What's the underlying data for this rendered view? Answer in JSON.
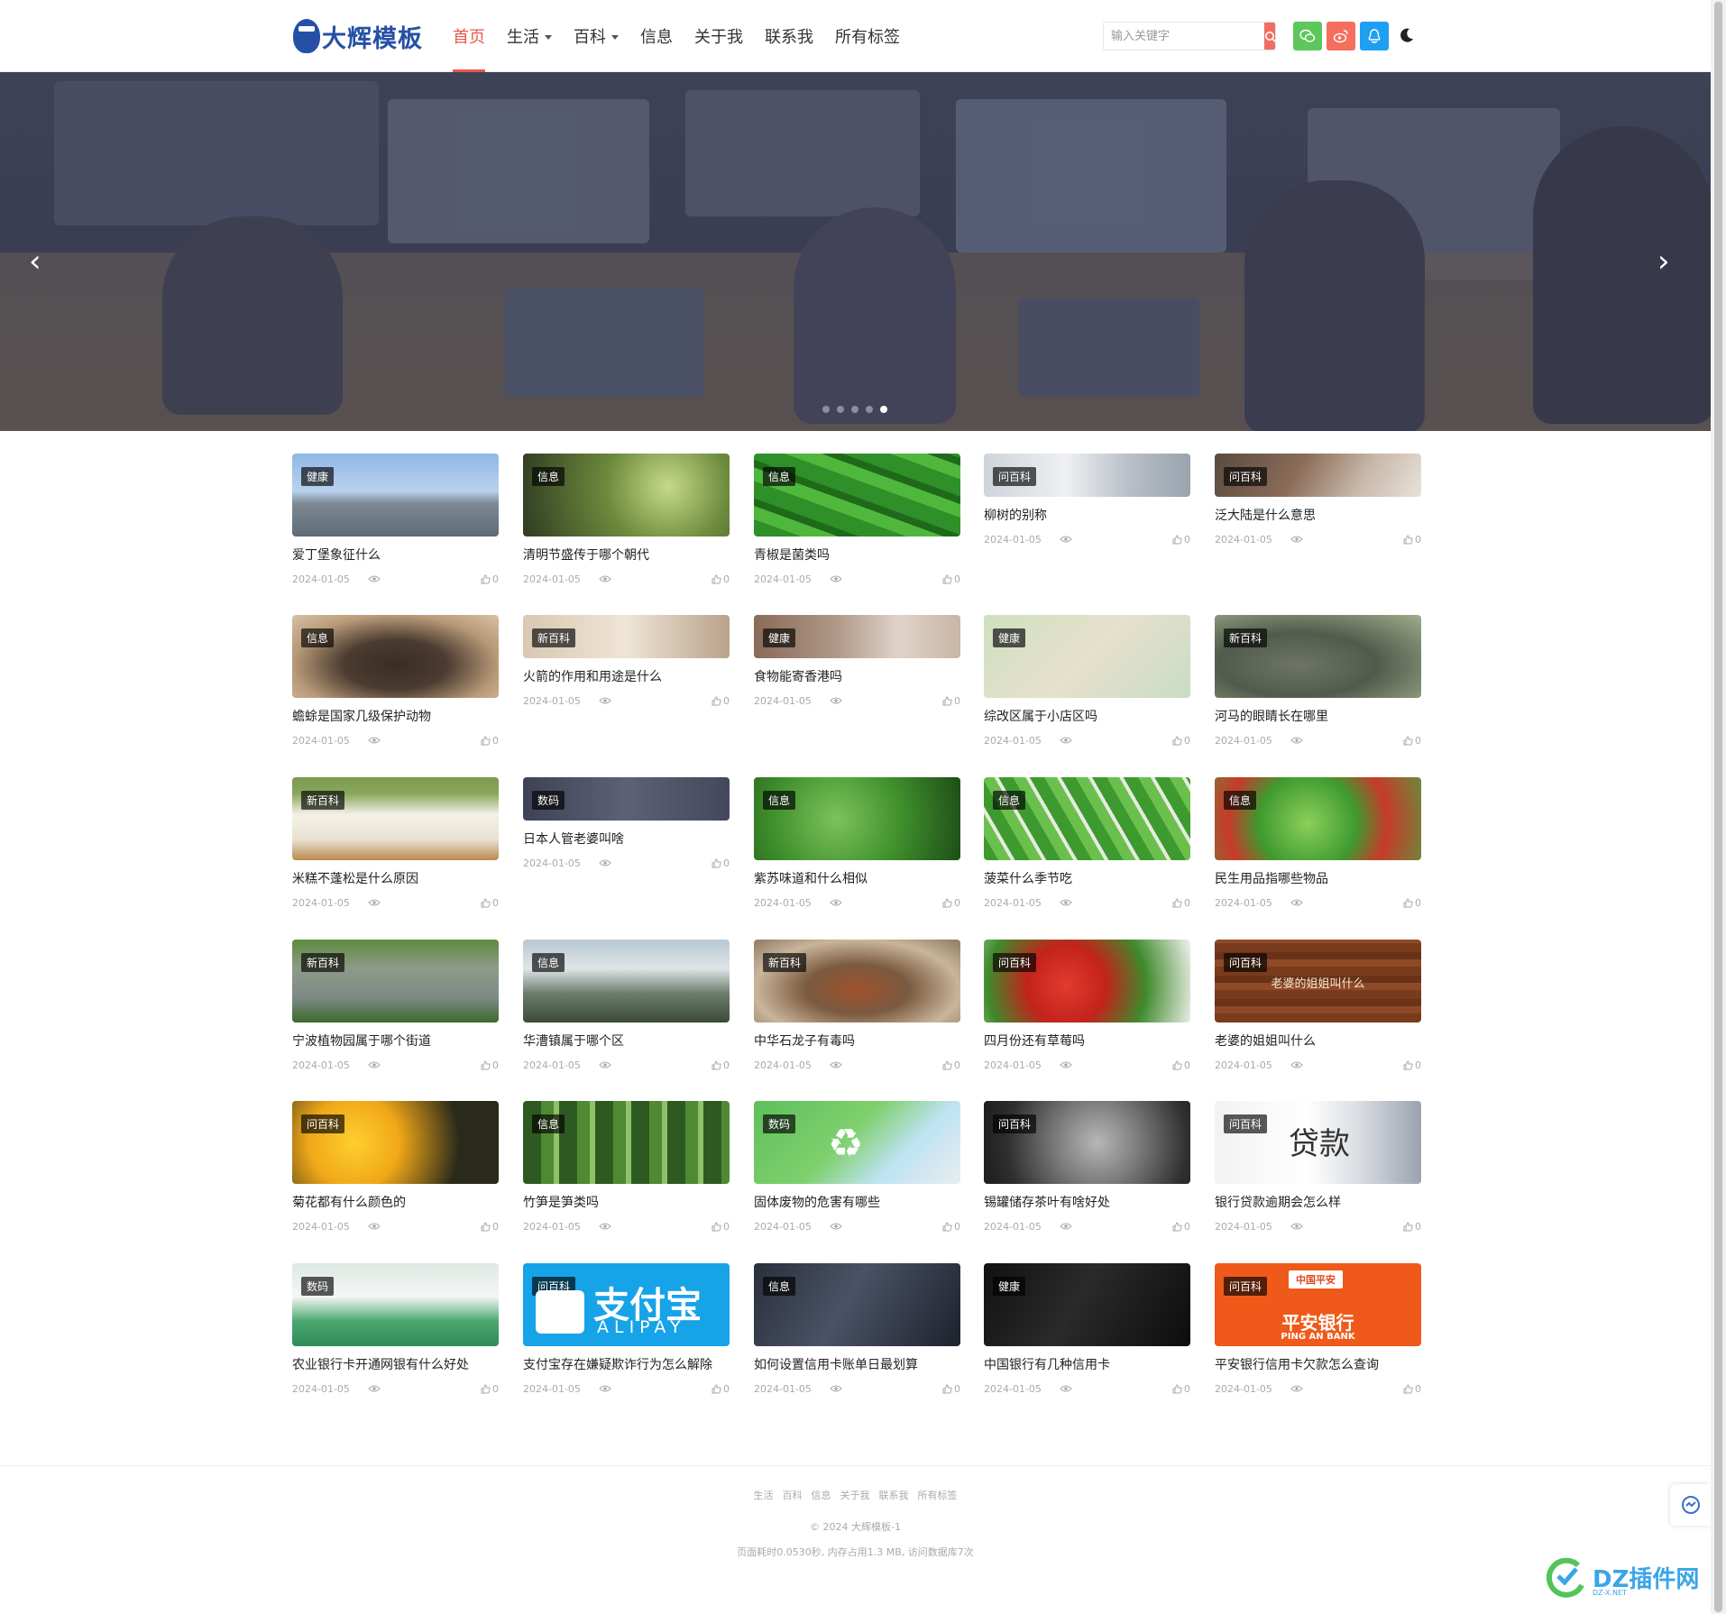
{
  "site": {
    "logo_text": "大辉模板"
  },
  "nav": [
    {
      "label": "首页",
      "active": true,
      "dropdown": false
    },
    {
      "label": "生活",
      "active": false,
      "dropdown": true
    },
    {
      "label": "百科",
      "active": false,
      "dropdown": true
    },
    {
      "label": "信息",
      "active": false,
      "dropdown": false
    },
    {
      "label": "关于我",
      "active": false,
      "dropdown": false
    },
    {
      "label": "联系我",
      "active": false,
      "dropdown": false
    },
    {
      "label": "所有标签",
      "active": false,
      "dropdown": false
    }
  ],
  "search": {
    "placeholder": "输入关键字"
  },
  "social": [
    {
      "icon": "wechat-icon",
      "color": "#5cc75b"
    },
    {
      "icon": "weibo-icon",
      "color": "#f56e5e"
    },
    {
      "icon": "qq-icon",
      "color": "#1e9ff2"
    }
  ],
  "banner": {
    "dots": 5,
    "active_dot": 4
  },
  "posts": [
    {
      "tag": "健康",
      "title": "爱丁堡象征什么",
      "date": "2024-01-05",
      "likes": "0",
      "img": "city"
    },
    {
      "tag": "信息",
      "title": "清明节盛传于哪个朝代",
      "date": "2024-01-05",
      "likes": "0",
      "img": "willow"
    },
    {
      "tag": "信息",
      "title": "青椒是菌类吗",
      "date": "2024-01-05",
      "likes": "0",
      "img": "pepper"
    },
    {
      "tag": "问百科",
      "title": "柳树的别称",
      "date": "2024-01-05",
      "likes": "0",
      "img": "office"
    },
    {
      "tag": "问百科",
      "title": "泛大陆是什么意思",
      "date": "2024-01-05",
      "likes": "0",
      "img": "desk"
    },
    {
      "tag": "信息",
      "title": "蟾蜍是国家几级保护动物",
      "date": "2024-01-05",
      "likes": "0",
      "img": "toad"
    },
    {
      "tag": "新百科",
      "title": "火箭的作用和用途是什么",
      "date": "2024-01-05",
      "likes": "0",
      "img": "cafe"
    },
    {
      "tag": "健康",
      "title": "食物能寄香港吗",
      "date": "2024-01-05",
      "likes": "0",
      "img": "desk2"
    },
    {
      "tag": "健康",
      "title": "综改区属于小店区吗",
      "date": "2024-01-05",
      "likes": "0",
      "img": "map"
    },
    {
      "tag": "新百科",
      "title": "河马的眼睛长在哪里",
      "date": "2024-01-05",
      "likes": "0",
      "img": "hippo"
    },
    {
      "tag": "新百科",
      "title": "米糕不蓬松是什么原因",
      "date": "2024-01-05",
      "likes": "0",
      "img": "cake"
    },
    {
      "tag": "数码",
      "title": "日本人管老婆叫啥",
      "date": "2024-01-05",
      "likes": "0",
      "img": "laptop"
    },
    {
      "tag": "信息",
      "title": "紫苏味道和什么相似",
      "date": "2024-01-05",
      "likes": "0",
      "img": "leaf"
    },
    {
      "tag": "信息",
      "title": "菠菜什么季节吃",
      "date": "2024-01-05",
      "likes": "0",
      "img": "spinach"
    },
    {
      "tag": "信息",
      "title": "民生用品指哪些物品",
      "date": "2024-01-05",
      "likes": "0",
      "img": "veg"
    },
    {
      "tag": "新百科",
      "title": "宁波植物园属于哪个街道",
      "date": "2024-01-05",
      "likes": "0",
      "img": "rock"
    },
    {
      "tag": "信息",
      "title": "华漕镇属于哪个区",
      "date": "2024-01-05",
      "likes": "0",
      "img": "bridge"
    },
    {
      "tag": "新百科",
      "title": "中华石龙子有毒吗",
      "date": "2024-01-05",
      "likes": "0",
      "img": "lizard"
    },
    {
      "tag": "问百科",
      "title": "四月份还有草莓吗",
      "date": "2024-01-05",
      "likes": "0",
      "img": "berry"
    },
    {
      "tag": "问百科",
      "title": "老婆的姐姐叫什么",
      "date": "2024-01-05",
      "likes": "0",
      "img": "wood",
      "overlay": "老婆的姐姐叫什么"
    },
    {
      "tag": "问百科",
      "title": "菊花都有什么颜色的",
      "date": "2024-01-05",
      "likes": "0",
      "img": "mum"
    },
    {
      "tag": "信息",
      "title": "竹笋是笋类吗",
      "date": "2024-01-05",
      "likes": "0",
      "img": "bamboo"
    },
    {
      "tag": "数码",
      "title": "固体废物的危害有哪些",
      "date": "2024-01-05",
      "likes": "0",
      "img": "recycle"
    },
    {
      "tag": "问百科",
      "title": "锡罐储存茶叶有啥好处",
      "date": "2024-01-05",
      "likes": "0",
      "img": "tin"
    },
    {
      "tag": "问百科",
      "title": "银行贷款逾期会怎么样",
      "date": "2024-01-05",
      "likes": "0",
      "img": "loan",
      "overlay": "贷款"
    },
    {
      "tag": "数码",
      "title": "农业银行卡开通网银有什么好处",
      "date": "2024-01-05",
      "likes": "0",
      "img": "bank"
    },
    {
      "tag": "问百科",
      "title": "支付宝存在嫌疑欺诈行为怎么解除",
      "date": "2024-01-05",
      "likes": "0",
      "img": "alipay",
      "overlay": "支付宝",
      "overlay2": "ALIPAY"
    },
    {
      "tag": "信息",
      "title": "如何设置信用卡账单日最划算",
      "date": "2024-01-05",
      "likes": "0",
      "img": "cards"
    },
    {
      "tag": "健康",
      "title": "中国银行有几种信用卡",
      "date": "2024-01-05",
      "likes": "0",
      "img": "boc"
    },
    {
      "tag": "问百科",
      "title": "平安银行信用卡欠款怎么查询",
      "date": "2024-01-05",
      "likes": "0",
      "img": "pingan",
      "overlay": "平安银行",
      "overlay2": "PING AN BANK",
      "overlay3": "中国平安"
    }
  ],
  "footer": {
    "links": [
      "生活",
      "百科",
      "信息",
      "关于我",
      "联系我",
      "所有标签"
    ],
    "copyright": "© 2024 大辉模板-1",
    "stats": "页面耗时0.0530秒, 内存占用1.3 MB, 访问数据库7次"
  },
  "watermark": {
    "text": "DZ插件网",
    "sub": "DZ-X.NET"
  }
}
